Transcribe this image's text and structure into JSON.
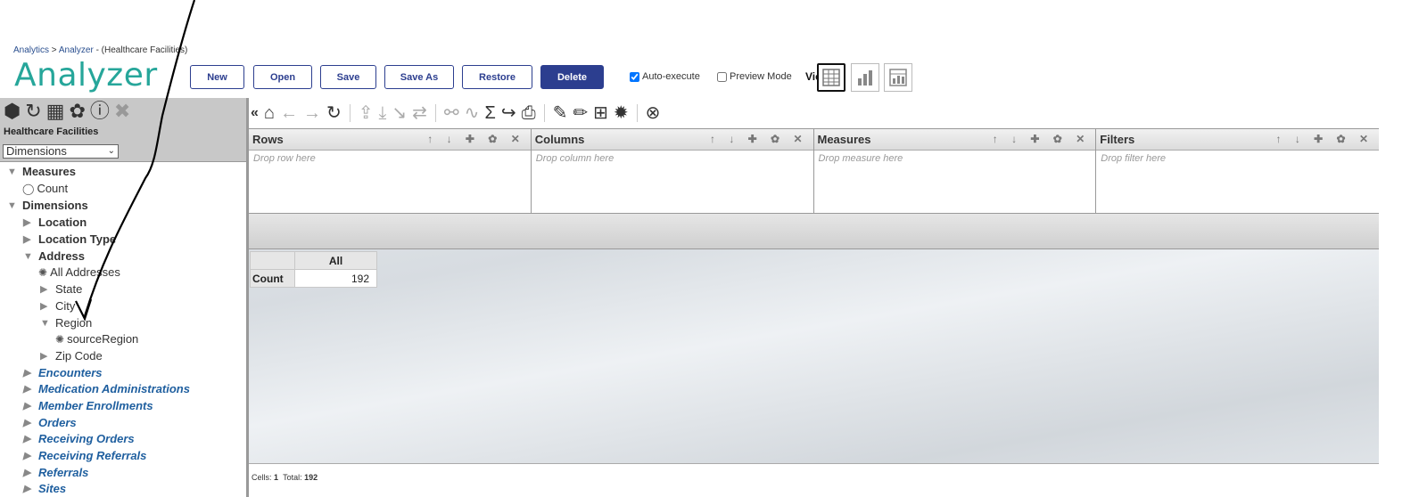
{
  "breadcrumb": {
    "root": "Analytics",
    "sep": ">",
    "current": "Analyzer",
    "context": "- (Healthcare Facilities)"
  },
  "app_title": "Analyzer",
  "toolbar_buttons": {
    "new": "New",
    "open": "Open",
    "save": "Save",
    "save_as": "Save As",
    "restore": "Restore",
    "delete": "Delete"
  },
  "options": {
    "auto_execute": "Auto-execute",
    "auto_execute_checked": true,
    "preview_mode": "Preview Mode",
    "preview_mode_checked": false,
    "view_label": "View:"
  },
  "left_panel": {
    "datasource": "Healthcare Facilities",
    "selector": "Dimensions",
    "tree": [
      {
        "label": "Measures",
        "toggle": "▼"
      },
      {
        "label": "Count",
        "icon": "count-icon"
      },
      {
        "label": "Dimensions",
        "toggle": "▼"
      },
      {
        "label": "Location",
        "toggle": "▶"
      },
      {
        "label": "Location Type",
        "toggle": "▶"
      },
      {
        "label": "Address",
        "toggle": "▼"
      },
      {
        "label": "All Addresses",
        "icon": "member-icon"
      },
      {
        "label": "State",
        "toggle": "▶"
      },
      {
        "label": "City",
        "toggle": "▶"
      },
      {
        "label": "Region",
        "toggle": "▼"
      },
      {
        "label": "sourceRegion",
        "icon": "member-icon"
      },
      {
        "label": "Zip Code",
        "toggle": "▶"
      },
      {
        "label": "Encounters",
        "toggle": "▶"
      },
      {
        "label": "Medication Administrations",
        "toggle": "▶"
      },
      {
        "label": "Member Enrollments",
        "toggle": "▶"
      },
      {
        "label": "Orders",
        "toggle": "▶"
      },
      {
        "label": "Receiving Orders",
        "toggle": "▶"
      },
      {
        "label": "Receiving Referrals",
        "toggle": "▶"
      },
      {
        "label": "Referrals",
        "toggle": "▶"
      },
      {
        "label": "Sites",
        "toggle": "▶"
      }
    ]
  },
  "zones": {
    "rows": {
      "title": "Rows",
      "placeholder": "Drop row here"
    },
    "columns": {
      "title": "Columns",
      "placeholder": "Drop column here"
    },
    "measures": {
      "title": "Measures",
      "placeholder": "Drop measure here"
    },
    "filters": {
      "title": "Filters",
      "placeholder": "Drop filter here"
    },
    "controls": "↑ ↓ ✚ ✿ ✕"
  },
  "pivot": {
    "column_header": "All",
    "row_header": "Count",
    "value": "192"
  },
  "status": {
    "cells_label": "Cells:",
    "cells": "1",
    "total_label": "Total:",
    "total": "192"
  },
  "colors": {
    "accent": "#26a69a",
    "button_border": "#2c3e8f",
    "delete_bg": "#2c3e8f",
    "tree_link": "#1f5f9f"
  }
}
